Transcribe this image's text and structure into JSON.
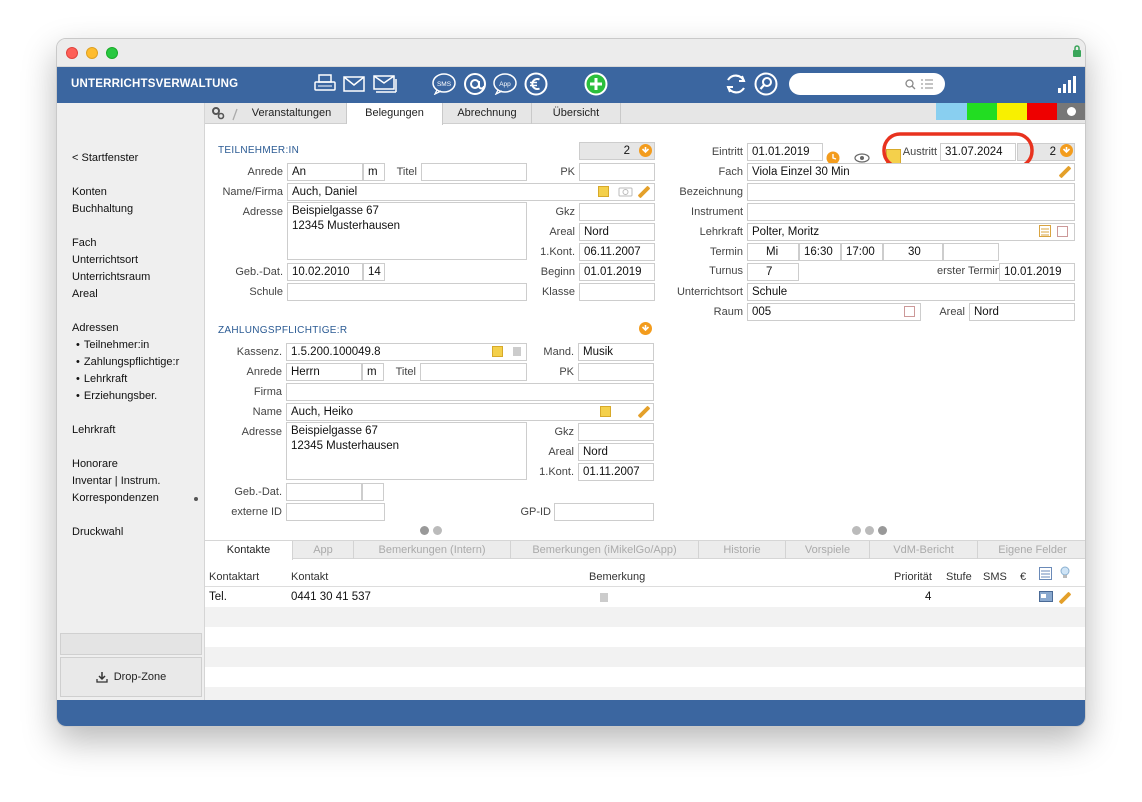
{
  "app": {
    "title": "UNTERRICHTSVERWALTUNG"
  },
  "toolbar": {
    "sms_label": "SMS",
    "app_label": "App",
    "search_placeholder": ""
  },
  "sidebar": {
    "back": "< Startfenster",
    "items": [
      {
        "label": "Konten"
      },
      {
        "label": "Buchhaltung"
      },
      {
        "label": "Fach"
      },
      {
        "label": "Unterrichtsort"
      },
      {
        "label": "Unterrichtsraum"
      },
      {
        "label": "Areal"
      },
      {
        "label": "Adressen"
      },
      {
        "label": "Teilnehmer:in"
      },
      {
        "label": "Zahlungspflichtige:r"
      },
      {
        "label": "Lehrkraft"
      },
      {
        "label": "Erziehungsber."
      },
      {
        "label": "Lehrkraft"
      },
      {
        "label": "Honorare"
      },
      {
        "label": "Inventar | Instrum."
      },
      {
        "label": "Korrespondenzen"
      },
      {
        "label": "Druckwahl"
      }
    ],
    "dropzone": "Drop-Zone"
  },
  "tabs": [
    "Veranstaltungen",
    "Belegungen",
    "Abrechnung",
    "Übersicht"
  ],
  "colors": {
    "light_blue": "#89cff0",
    "green": "#22dd22",
    "yellow": "#f8f000",
    "red": "#ee0000",
    "dark": "#777777"
  },
  "teilnehmer": {
    "section": "TEILNEHMER:IN",
    "count": "2",
    "anrede_label": "Anrede",
    "anrede": "An",
    "gender": "m",
    "titel_label": "Titel",
    "titel": "",
    "pk_label": "PK",
    "pk": "",
    "name_label": "Name/Firma",
    "name": "Auch, Daniel",
    "adresse_label": "Adresse",
    "adresse1": "Beispielgasse 67",
    "adresse2": "12345 Musterhausen",
    "gkz_label": "Gkz",
    "gkz": "",
    "areal_label": "Areal",
    "areal": "Nord",
    "kont_label": "1.Kont.",
    "kont": "06.11.2007",
    "geb_label": "Geb.-Dat.",
    "geb": "10.02.2010",
    "alter": "14",
    "beginn_label": "Beginn",
    "beginn": "01.01.2019",
    "schule_label": "Schule",
    "schule": "",
    "klasse_label": "Klasse",
    "klasse": ""
  },
  "zahlung": {
    "section": "ZAHLUNGSPFLICHTIGE:R",
    "kassenz_label": "Kassenz.",
    "kassenz": "1.5.200.100049.8",
    "mand_label": "Mand.",
    "mand": "Musik",
    "anrede_label": "Anrede",
    "anrede": "Herrn",
    "gender": "m",
    "titel_label": "Titel",
    "titel": "",
    "pk_label": "PK",
    "pk": "",
    "firma_label": "Firma",
    "firma": "",
    "name_label": "Name",
    "name": "Auch, Heiko",
    "adresse_label": "Adresse",
    "adresse1": "Beispielgasse 67",
    "adresse2": "12345 Musterhausen",
    "gkz_label": "Gkz",
    "gkz": "",
    "areal_label": "Areal",
    "areal": "Nord",
    "kont_label": "1.Kont.",
    "kont": "01.11.2007",
    "geb_label": "Geb.-Dat.",
    "geb": "",
    "geb2": "",
    "extid_label": "externe ID",
    "extid": "",
    "gpid_label": "GP-ID",
    "gpid": ""
  },
  "belegung": {
    "eintritt_label": "Eintritt",
    "eintritt": "01.01.2019",
    "austritt_label": "Austritt",
    "austritt": "31.07.2024",
    "count": "2",
    "fach_label": "Fach",
    "fach": "Viola Einzel 30 Min",
    "bezeichnung_label": "Bezeichnung",
    "bezeichnung": "",
    "instrument_label": "Instrument",
    "instrument": "",
    "lehrkraft_label": "Lehrkraft",
    "lehrkraft": "Polter, Moritz",
    "termin_label": "Termin",
    "tag": "Mi",
    "von": "16:30",
    "bis": "17:00",
    "dauer": "30",
    "extra": "",
    "turnus_label": "Turnus",
    "turnus": "7",
    "erster_label": "erster Termin",
    "erster": "10.01.2019",
    "ort_label": "Unterrichtsort",
    "ort": "Schule",
    "raum_label": "Raum",
    "raum": "005",
    "areal_label": "Areal",
    "areal": "Nord"
  },
  "bottom_tabs": [
    "Kontakte",
    "App",
    "Bemerkungen (Intern)",
    "Bemerkungen (iMikelGo/App)",
    "Historie",
    "Vorspiele",
    "VdM-Bericht",
    "Eigene Felder"
  ],
  "contacts": {
    "headers": {
      "kontaktart": "Kontaktart",
      "kontakt": "Kontakt",
      "bemerkung": "Bemerkung",
      "prioritaet": "Priorität",
      "stufe": "Stufe",
      "sms": "SMS",
      "euro": "€"
    },
    "rows": [
      {
        "kontaktart": "Tel.",
        "kontakt": "0441 30 41 537",
        "bemerkung": "",
        "prioritaet": "4",
        "stufe": "",
        "sms": ""
      }
    ]
  }
}
